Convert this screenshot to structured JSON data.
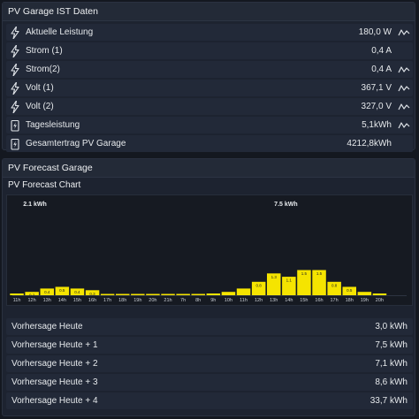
{
  "ist": {
    "title": "PV Garage IST Daten",
    "rows": [
      {
        "label": "Aktuelle Leistung",
        "value": "180,0 W",
        "icon": "lightning-icon",
        "trend": true
      },
      {
        "label": "Strom (1)",
        "value": "0,4 A",
        "icon": "lightning-icon",
        "trend": false
      },
      {
        "label": "Strom(2)",
        "value": "0,4 A",
        "icon": "lightning-icon",
        "trend": true
      },
      {
        "label": "Volt (1)",
        "value": "367,1 V",
        "icon": "lightning-icon",
        "trend": true
      },
      {
        "label": "Volt (2)",
        "value": "327,0 V",
        "icon": "lightning-icon",
        "trend": true
      },
      {
        "label": "Tagesleistung",
        "value": "5,1kWh",
        "icon": "battery-charge-icon",
        "trend": true
      },
      {
        "label": "Gesamtertrag PV Garage",
        "value": "4212,8kWh",
        "icon": "battery-charge-icon",
        "trend": false
      }
    ]
  },
  "forecast": {
    "title": "PV Forecast Garage",
    "chart_title": "PV Forecast Chart",
    "rows": [
      {
        "label": "Vorhersage Heute",
        "value": "3,0 kWh"
      },
      {
        "label": "Vorhersage Heute + 1",
        "value": "7,5 kWh"
      },
      {
        "label": "Vorhersage Heute + 2",
        "value": "7,1 kWh"
      },
      {
        "label": "Vorhersage Heute + 3",
        "value": "8,6 kWh"
      },
      {
        "label": "Vorhersage Heute + 4",
        "value": "33,7 kWh"
      }
    ]
  },
  "chart_data": {
    "type": "bar",
    "bar_color": "#f5e400",
    "ylim": [
      0,
      5
    ],
    "grid": false,
    "days": [
      {
        "total_label": "2.1 kWh",
        "categories": [
          "11h",
          "12h",
          "13h",
          "14h",
          "15h",
          "16h",
          "17h",
          "18h",
          "19h",
          "20h",
          "21h",
          "7h",
          "8h"
        ],
        "values": [
          0.1,
          0.2,
          0.4,
          0.5,
          0.4,
          0.3,
          0,
          0,
          0,
          0,
          0,
          0,
          0
        ],
        "value_labels": [
          "",
          "0.2",
          "0.4",
          "0.5",
          "0.4",
          "0.3",
          "",
          "",
          "",
          "",
          "",
          "",
          ""
        ]
      },
      {
        "total_label": "7.5 kWh",
        "categories": [
          "9h",
          "10h",
          "11h",
          "12h",
          "13h",
          "14h",
          "15h",
          "16h",
          "17h",
          "18h",
          "19h",
          "20h"
        ],
        "values": [
          0.1,
          0.2,
          0.4,
          0.8,
          1.3,
          1.1,
          1.5,
          1.5,
          0.8,
          0.5,
          0.2,
          0.1
        ],
        "value_labels": [
          "",
          "",
          "",
          "0.8",
          "1.3",
          "1.1",
          "1.5",
          "1.5",
          "0.8",
          "0.5",
          "",
          ""
        ]
      }
    ]
  }
}
